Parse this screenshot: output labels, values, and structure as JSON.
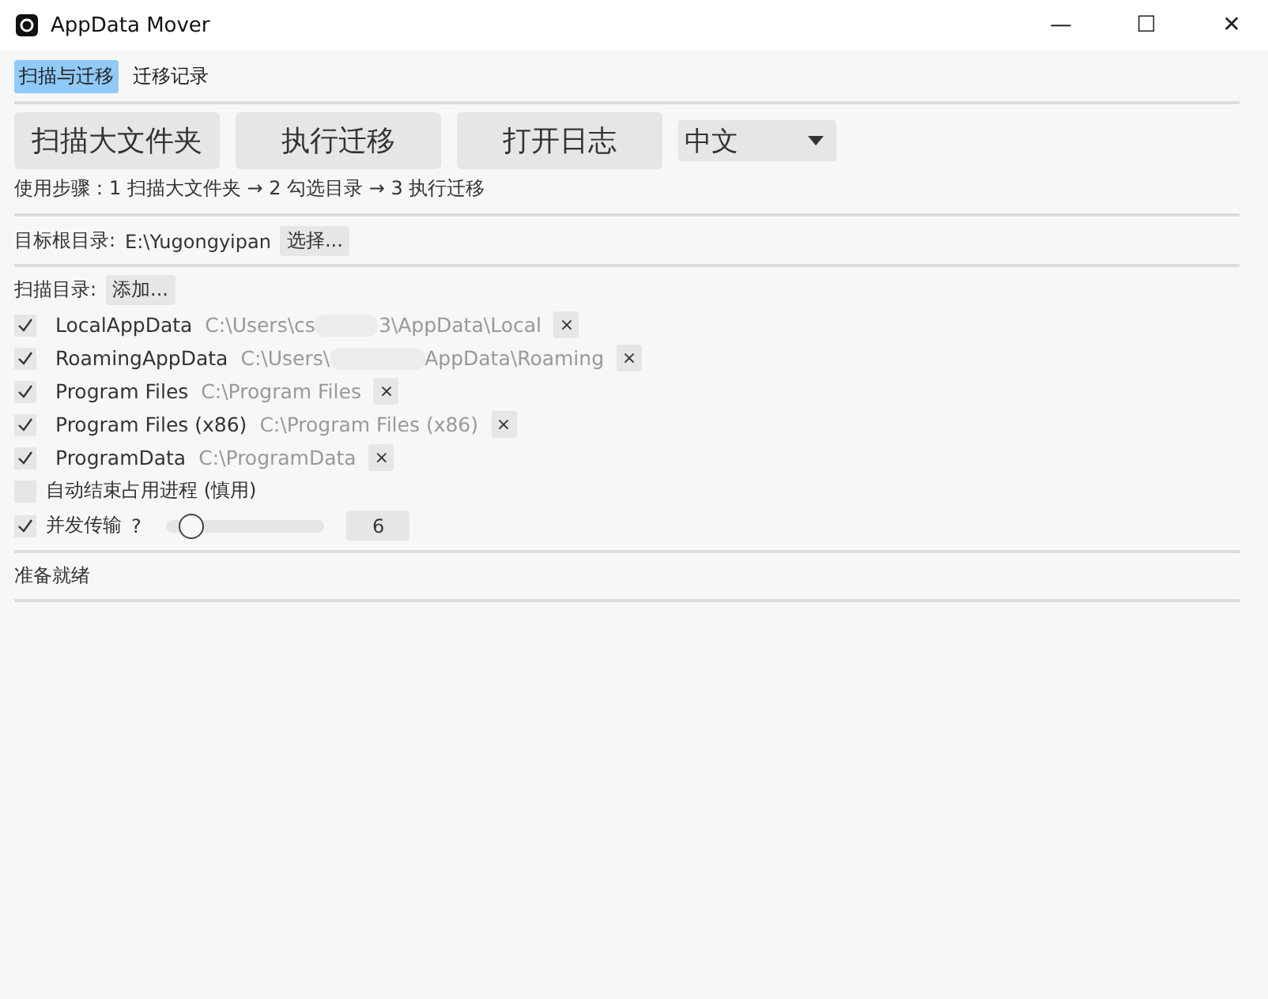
{
  "window": {
    "title": "AppData Mover",
    "controls": [
      "—",
      "☐",
      "✕"
    ]
  },
  "tabs": [
    {
      "label": "扫描与迁移",
      "selected": true
    },
    {
      "label": "迁移记录",
      "selected": false
    }
  ],
  "toolbar": {
    "buttons": [
      "扫描大文件夹",
      "执行迁移",
      "打开日志"
    ],
    "language": "中文"
  },
  "steps": "使用步骤：1 扫描大文件夹 → 2 勾选目录 → 3 执行迁移",
  "target": {
    "label": "目标根目录:",
    "path": "E:\\Yugongyipan",
    "button": "选择..."
  },
  "scan": {
    "label": "扫描目录:",
    "button": "添加...",
    "dirs": [
      {
        "name": "LocalAppData",
        "path": "C:\\Users\\cs",
        "path_tail": "3\\AppData\\Local",
        "checked": true
      },
      {
        "name": "RoamingAppData",
        "path": "C:\\Users\\",
        "path_tail": "AppData\\Roaming",
        "checked": true
      },
      {
        "name": "Program Files",
        "path": "C:\\Program Files",
        "checked": true
      },
      {
        "name": "Program Files (x86)",
        "path": "C:\\Program Files (x86)",
        "checked": true
      },
      {
        "name": "ProgramData",
        "path": "C:\\ProgramData",
        "checked": true
      }
    ],
    "remove": "×"
  },
  "auto_kill": {
    "label": "自动结束占用进程 (慎用)",
    "checked": false
  },
  "concurrency": {
    "label": "并发传输",
    "help": "?",
    "checked": true,
    "level": 0.16,
    "value": "6"
  },
  "status": "准备就绪"
}
